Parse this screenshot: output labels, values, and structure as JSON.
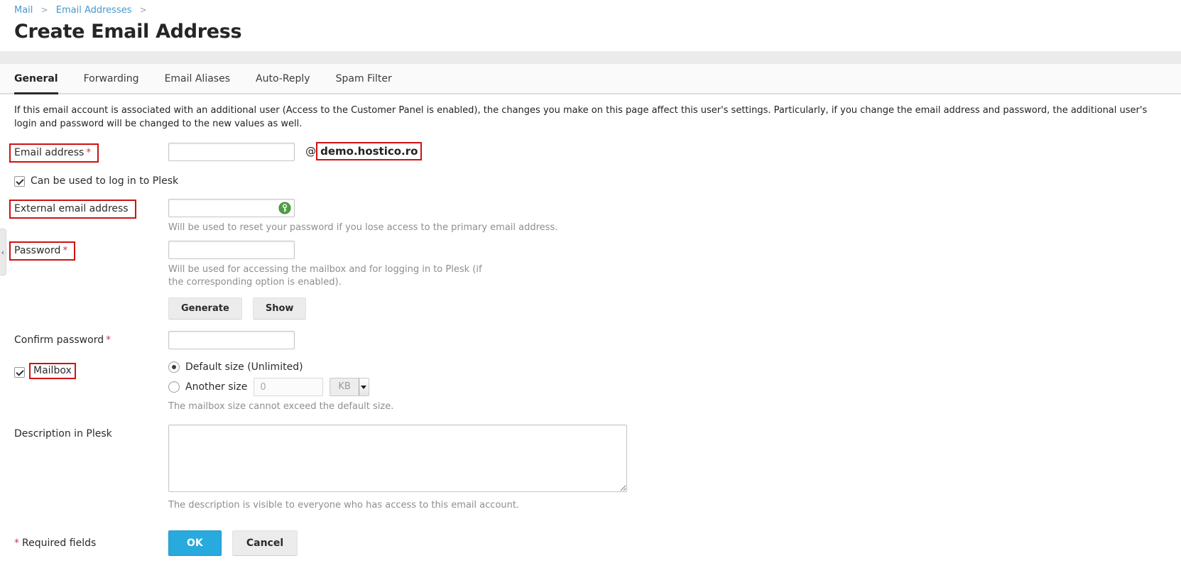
{
  "breadcrumb": {
    "items": [
      "Mail",
      "Email Addresses"
    ],
    "separator": ">"
  },
  "page": {
    "title": "Create Email Address"
  },
  "tabs": [
    {
      "label": "General",
      "active": true
    },
    {
      "label": "Forwarding",
      "active": false
    },
    {
      "label": "Email Aliases",
      "active": false
    },
    {
      "label": "Auto-Reply",
      "active": false
    },
    {
      "label": "Spam Filter",
      "active": false
    }
  ],
  "info_text": "If this email account is associated with an additional user (Access to the Customer Panel is enabled), the changes you make on this page affect this user's settings. Particularly, if you change the email address and password, the additional user's login and password will be changed to the new values as well.",
  "form": {
    "email": {
      "label": "Email address",
      "required_mark": "*",
      "value": "",
      "at": "@",
      "domain": "demo.hostico.ro"
    },
    "login_checkbox": {
      "label": "Can be used to log in to Plesk",
      "checked": true
    },
    "external_email": {
      "label": "External email address",
      "value": "",
      "hint": "Will be used to reset your password if you lose access to the primary email address.",
      "icon": "key-icon"
    },
    "password": {
      "label": "Password",
      "required_mark": "*",
      "value": "",
      "hint": "Will be used for accessing the mailbox and for logging in to Plesk (if the corresponding option is enabled).",
      "generate_label": "Generate",
      "show_label": "Show"
    },
    "confirm_password": {
      "label": "Confirm password",
      "required_mark": "*",
      "value": ""
    },
    "mailbox": {
      "label": "Mailbox",
      "checked": true,
      "default_size": {
        "label": "Default size (Unlimited)",
        "selected": true
      },
      "another_size": {
        "label": "Another size",
        "selected": false,
        "placeholder": "0",
        "unit": "KB"
      },
      "hint": "The mailbox size cannot exceed the default size."
    },
    "description": {
      "label": "Description in Plesk",
      "value": "",
      "hint": "The description is visible to everyone who has access to this email account."
    },
    "required_note": {
      "mark": "*",
      "text": "Required fields"
    },
    "buttons": {
      "ok": "OK",
      "cancel": "Cancel"
    }
  },
  "sidebar_toggle": {
    "glyph": "‹"
  },
  "colors": {
    "accent_blue": "#28aade",
    "link_blue": "#4699cc",
    "annotation_red": "#ce1212",
    "required_red": "#bf4158",
    "key_icon_green": "#4ca13f"
  }
}
